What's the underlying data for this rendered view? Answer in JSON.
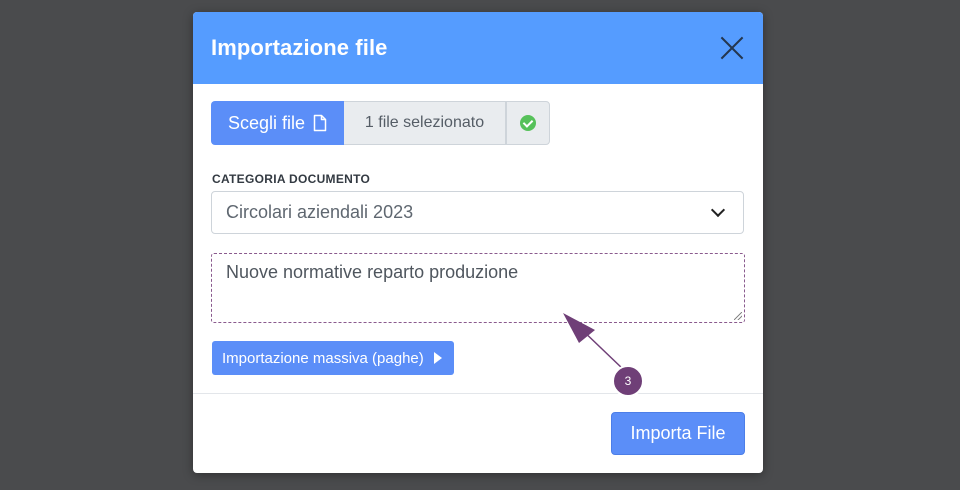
{
  "dialog": {
    "title": "Importazione file",
    "close_icon": "close-icon"
  },
  "file_picker": {
    "choose_label": "Scegli file",
    "choose_icon": "file-icon",
    "status_text": "1 file selezionato",
    "status_icon": "check-circle-icon",
    "status_color": "#56c15a"
  },
  "category": {
    "label": "CATEGORIA DOCUMENTO",
    "selected": "Circolari aziendali 2023"
  },
  "description": {
    "value": "Nuove normative reparto produzione"
  },
  "bulk_import": {
    "label": "Importazione massiva (paghe)"
  },
  "footer": {
    "import_label": "Importa File"
  },
  "annotation": {
    "badge_number": "3",
    "color": "#6f3f77"
  },
  "colors": {
    "header": "#559cff",
    "primary_button": "#5b8ef8",
    "backdrop": "#4a4b4d"
  }
}
